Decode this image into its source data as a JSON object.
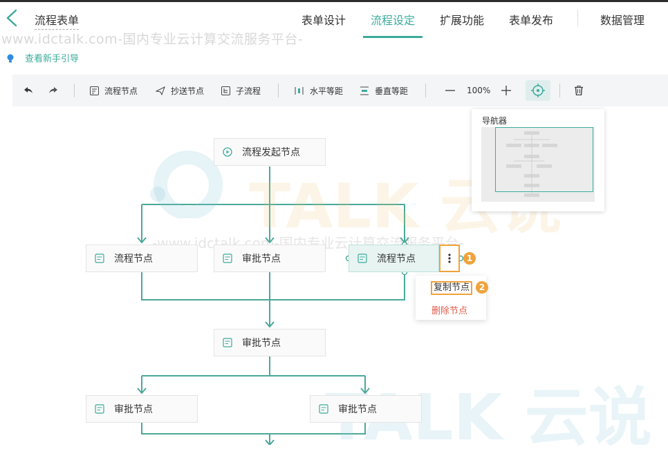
{
  "header": {
    "app_title": "流程表单",
    "tabs": [
      {
        "label": "表单设计"
      },
      {
        "label": "流程设定",
        "active": true
      },
      {
        "label": "扩展功能"
      },
      {
        "label": "表单发布"
      },
      {
        "label": "数据管理"
      }
    ],
    "watermark_text": "www.idctalk.com-国内专业云计算交流服务平台-"
  },
  "guide_link": "查看新手引导",
  "toolbar": {
    "undo_icon": "undo-icon",
    "redo_icon": "redo-icon",
    "flow_node": "流程节点",
    "cc_node": "抄送节点",
    "sub_flow": "子流程",
    "h_equal": "水平等距",
    "v_equal": "垂直等距",
    "zoom": "100%",
    "zoom_out_icon": "minus-icon",
    "zoom_in_icon": "plus-icon",
    "locate_icon": "crosshair-icon",
    "delete_icon": "trash-icon"
  },
  "navigator": {
    "title": "导航器"
  },
  "flow": {
    "start": "流程发起节点",
    "row1": [
      "流程节点",
      "审批节点",
      "流程节点"
    ],
    "merge": "审批节点",
    "row2": [
      "审批节点",
      "审批节点"
    ]
  },
  "context_menu": {
    "copy": "复制节点",
    "delete": "删除节点"
  },
  "badges": [
    "1",
    "2"
  ],
  "watermark": {
    "brand": "TALK 云说",
    "line": "-www.idctalk.com-国内专业云计算交流服务平台-"
  },
  "colors": {
    "accent": "#3bab9b",
    "highlight": "#f0a23a",
    "danger": "#e05a4a"
  }
}
